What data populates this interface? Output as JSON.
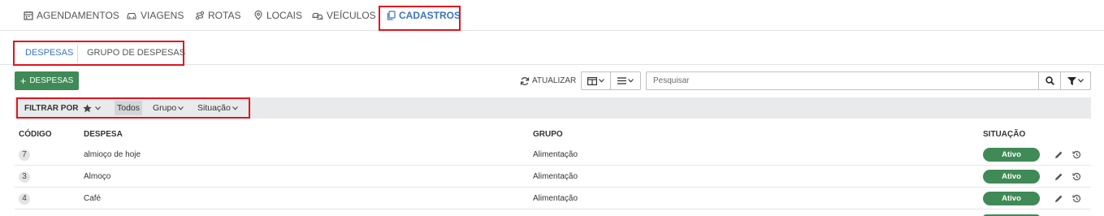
{
  "nav": {
    "items": [
      {
        "label": "AGENDAMENTOS",
        "icon": "calendar-icon"
      },
      {
        "label": "VIAGENS",
        "icon": "car-icon"
      },
      {
        "label": "ROTAS",
        "icon": "route-icon"
      },
      {
        "label": "LOCAIS",
        "icon": "map-pin-icon"
      },
      {
        "label": "VEÍCULOS",
        "icon": "vehicles-icon"
      },
      {
        "label": "CADASTROS",
        "icon": "copy-icon",
        "active": true
      }
    ]
  },
  "subtabs": [
    {
      "label": "DESPESAS",
      "active": true
    },
    {
      "label": "GRUPO DE DESPESAS"
    }
  ],
  "toolbar": {
    "add_label": "DESPESAS",
    "refresh_label": "ATUALIZAR",
    "search_placeholder": "Pesquisar"
  },
  "filterbar": {
    "label": "FILTRAR POR",
    "todos": "Todos",
    "grupo": "Grupo",
    "situacao": "Situação"
  },
  "table": {
    "headers": {
      "codigo": "CÓDIGO",
      "despesa": "DESPESA",
      "grupo": "GRUPO",
      "situacao": "SITUAÇÃO"
    },
    "rows": [
      {
        "codigo": "7",
        "despesa": "almioço de hoje",
        "grupo": "Alimentação",
        "situacao": "Ativo"
      },
      {
        "codigo": "3",
        "despesa": "Almoço",
        "grupo": "Alimentação",
        "situacao": "Ativo"
      },
      {
        "codigo": "4",
        "despesa": "Café",
        "grupo": "Alimentação",
        "situacao": "Ativo"
      }
    ]
  },
  "colors": {
    "accent": "#3a74c4",
    "success": "#3f8a56",
    "highlight": "#e0141c"
  }
}
